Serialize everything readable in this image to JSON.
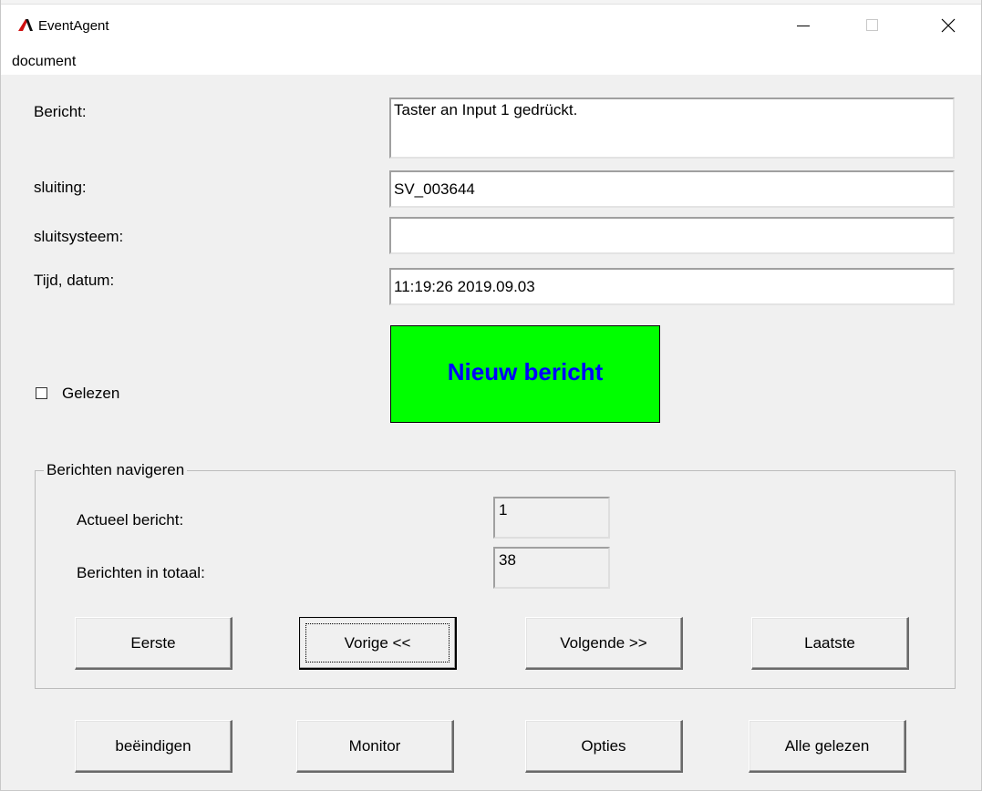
{
  "window": {
    "title": "EventAgent",
    "icons": {
      "app": "eventagent-logo-icon",
      "minimize": "minimize-icon",
      "maximize": "maximize-icon",
      "close": "close-icon"
    }
  },
  "menu": {
    "items": [
      "document"
    ]
  },
  "form": {
    "bericht_label": "Bericht:",
    "bericht_value": "Taster an Input 1 gedrückt.",
    "sluiting_label": "sluiting:",
    "sluiting_value": "SV_003644",
    "sluitsysteem_label": "sluitsysteem:",
    "sluitsysteem_value": "",
    "tijd_label": "Tijd, datum:",
    "tijd_value": "11:19:26 2019.09.03"
  },
  "status": {
    "text": "Nieuw bericht",
    "background": "#00ff00",
    "color": "#0000ff"
  },
  "gelezen": {
    "label": "Gelezen",
    "checked": false
  },
  "navigation": {
    "legend": "Berichten navigeren",
    "current_label": "Actueel bericht:",
    "current_value": "1",
    "total_label": "Berichten in totaal:",
    "total_value": "38",
    "buttons": {
      "first": "Eerste",
      "prev": "Vorige <<",
      "next": "Volgende >>",
      "last": "Laatste"
    }
  },
  "footer": {
    "buttons": {
      "quit": "beëindigen",
      "monitor": "Monitor",
      "options": "Opties",
      "all_read": "Alle gelezen"
    }
  }
}
